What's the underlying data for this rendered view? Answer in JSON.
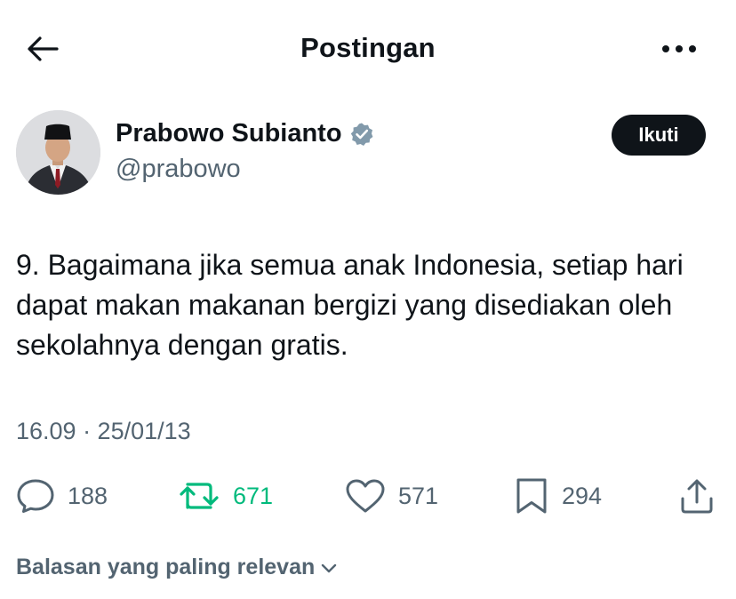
{
  "header": {
    "title": "Postingan",
    "back_icon": "arrow-left-icon",
    "more_icon": "more-horizontal-icon"
  },
  "author": {
    "name": "Prabowo Subianto",
    "handle": "@prabowo",
    "verified": true,
    "avatar_icon": "profile-photo",
    "follow_label": "Ikuti"
  },
  "tweet": {
    "text": "9. Bagaimana jika semua anak Indonesia, setiap hari dapat makan makanan bergizi yang disediakan oleh sekolahnya dengan gratis.",
    "timestamp": "16.09 · 25/01/13"
  },
  "actions": {
    "replies": "188",
    "retweets": "671",
    "likes": "571",
    "bookmarks": "294"
  },
  "replies_section": {
    "sort_label": "Balasan yang paling relevan"
  },
  "colors": {
    "text_primary": "#0f1419",
    "text_secondary": "#536471",
    "retweet_green": "#00ba7c",
    "verified_badge": "#829aab",
    "follow_bg": "#0f1419"
  }
}
